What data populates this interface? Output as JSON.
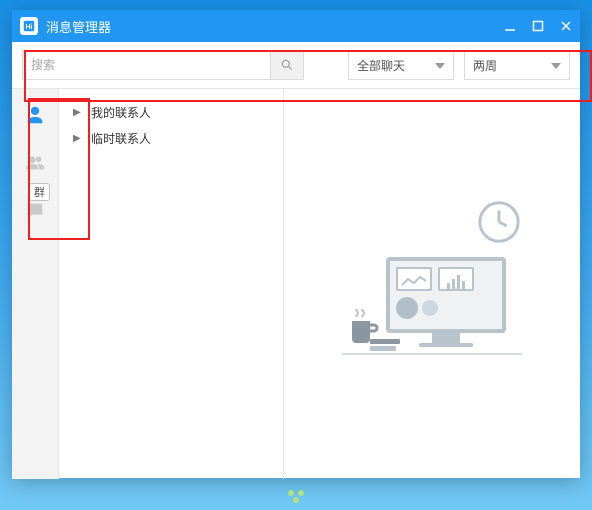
{
  "window": {
    "title": "消息管理器"
  },
  "search": {
    "placeholder": "搜索"
  },
  "filters": {
    "chat_type": "全部聊天",
    "time_range": "两周"
  },
  "rail": {
    "group_badge": "群"
  },
  "tree": {
    "items": [
      {
        "label": "我的联系人"
      },
      {
        "label": "临时联系人"
      }
    ]
  }
}
